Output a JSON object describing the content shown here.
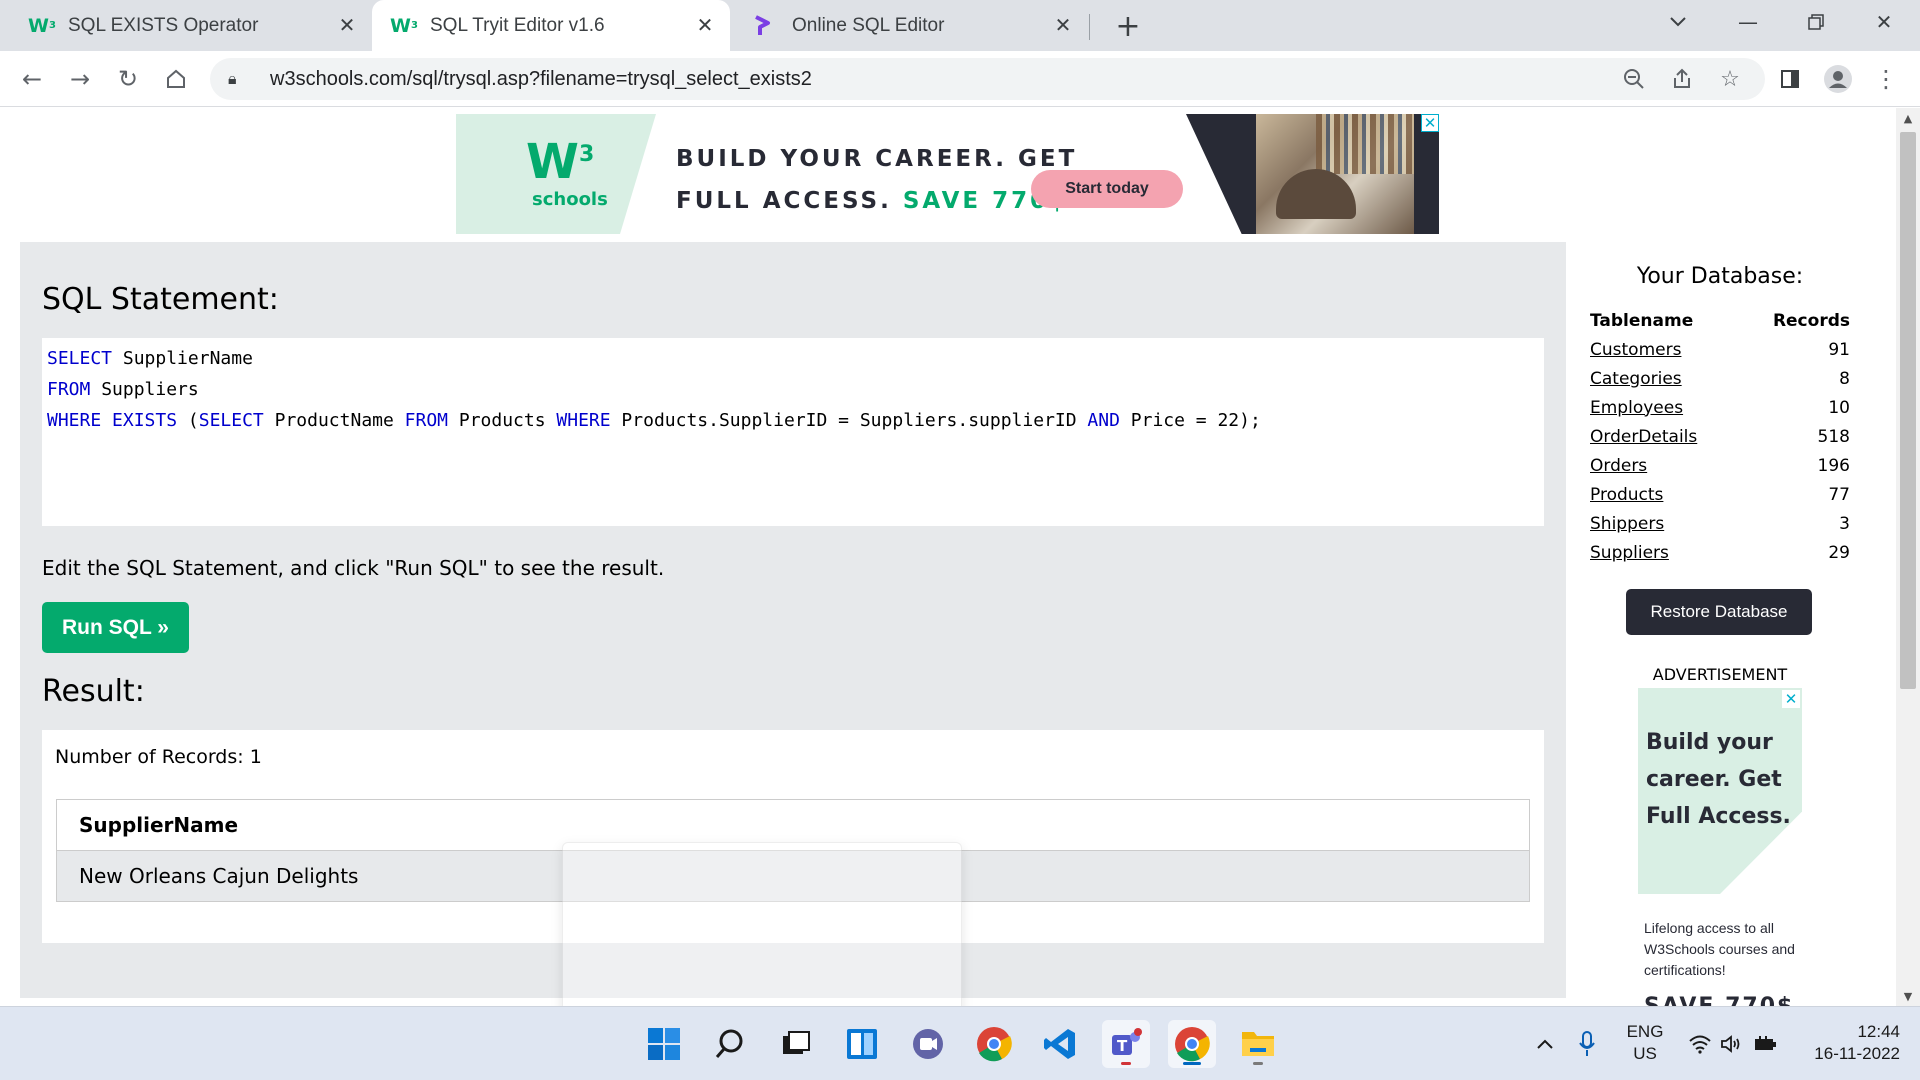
{
  "browser": {
    "tabs": [
      {
        "title": "SQL EXISTS Operator",
        "favicon": "w3schools-icon"
      },
      {
        "title": "SQL Tryit Editor v1.6",
        "favicon": "w3schools-icon"
      },
      {
        "title": "Online SQL Editor",
        "favicon": "programiz-icon"
      }
    ],
    "url": "w3schools.com/sql/trysql.asp?filename=trysql_select_exists2"
  },
  "banner": {
    "logo_text": "W",
    "logo_sup": "3",
    "logo_sub": "schools",
    "line1": "BUILD YOUR CAREER. GET",
    "line2_prefix": "FULL ACCESS.",
    "line2_highlight": "SAVE 770$",
    "cta": "Start today",
    "close": "✕"
  },
  "editor": {
    "sql_title": "SQL Statement:",
    "hint": "Edit the SQL Statement, and click \"Run SQL\" to see the result.",
    "run_label": "Run SQL »",
    "result_title": "Result:",
    "record_count_text": "Number of Records: 1",
    "result_columns": [
      "SupplierName"
    ],
    "result_rows": [
      [
        "New Orleans Cajun Delights"
      ]
    ]
  },
  "database": {
    "title": "Your Database:",
    "col_table": "Tablename",
    "col_records": "Records",
    "tables": [
      {
        "name": "Customers",
        "records": "91"
      },
      {
        "name": "Categories",
        "records": "8"
      },
      {
        "name": "Employees",
        "records": "10"
      },
      {
        "name": "OrderDetails",
        "records": "518"
      },
      {
        "name": "Orders",
        "records": "196"
      },
      {
        "name": "Products",
        "records": "77"
      },
      {
        "name": "Shippers",
        "records": "3"
      },
      {
        "name": "Suppliers",
        "records": "29"
      }
    ],
    "restore_label": "Restore Database"
  },
  "sidebar_ad": {
    "label": "ADVERTISEMENT",
    "headline": "Build your career. Get Full Access.",
    "sub": "Lifelong access to all W3Schools courses and certifications!",
    "save": "SAVE 770$"
  },
  "taskbar": {
    "apps": [
      "windows-start-icon",
      "search-icon",
      "task-view-icon",
      "widgets-icon",
      "teams-chat-icon",
      "chrome-icon",
      "vscode-icon",
      "teams-icon",
      "chrome-active-icon",
      "file-explorer-icon"
    ],
    "lang_line1": "ENG",
    "lang_line2": "US",
    "time": "12:44",
    "date": "16-11-2022"
  },
  "colors": {
    "w3_green": "#04aa6d",
    "dark": "#282a35",
    "panel_grey": "#e7e9eb",
    "sql_keyword": "#0000cd"
  }
}
